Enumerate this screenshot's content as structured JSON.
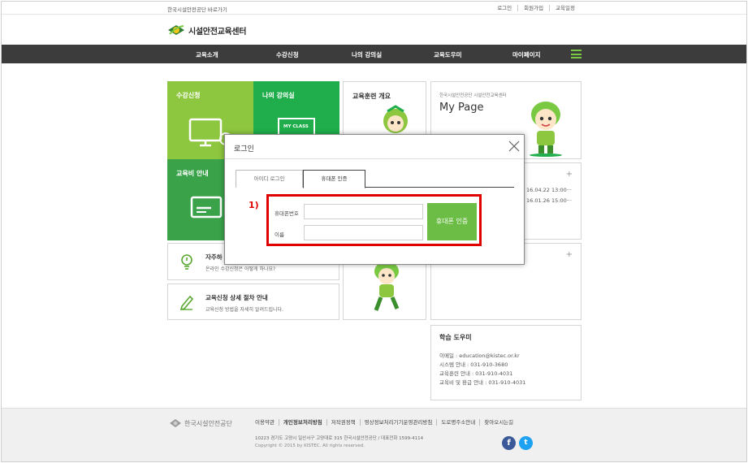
{
  "topbar": {
    "gov_link": "한국시설안전공단 바로가기",
    "util": [
      "로그인",
      "회원가입",
      "교육일정"
    ]
  },
  "logo": {
    "text": "시설안전교육센터"
  },
  "nav": {
    "items": [
      "교육소개",
      "수강신청",
      "나의 강의실",
      "교육도우미",
      "마이페이지"
    ]
  },
  "tiles": {
    "apply": "수강신청",
    "myclass": "나의 강의실",
    "myclass_badge": "MY CLASS",
    "fee": "교육비 안내",
    "overview": "교육훈련 개요",
    "mypage_sub": "한국시설안전공단 시설안전교육센터",
    "mypage_title": "My Page",
    "notice_dates": [
      "16.04.22 13:00···",
      "16.01.26 15:00···"
    ],
    "faq_title": "자주하",
    "faq_sub": "온라인 수강신청은 어떻게 하나요?",
    "guide_title": "교육신청 상세 절차 안내",
    "guide_sub": "교육신청 방법을 자세히 알려드립니다."
  },
  "help": {
    "title": "학습 도우미",
    "lines": [
      "이메일 : education@kistec.or.kr",
      "시스템 안내 : 031-910-3680",
      "교육훈련 안내 : 031-910-4031",
      "교육비 및 환급 안내 : 031-910-4031"
    ]
  },
  "modal": {
    "title": "로그인",
    "tabs": [
      "아이디 로그인",
      "휴대폰 인증"
    ],
    "annotation": "1)",
    "phone_label": "휴대폰번호",
    "name_label": "이름",
    "phone_value": "",
    "name_value": "",
    "auth_button": "휴대폰 인증"
  },
  "footer": {
    "org": "한국시설안전공단",
    "links": [
      "이용약관",
      "개인정보처리방침",
      "저작권정책",
      "영상정보처리기기운영관리방침",
      "도로명주소안내",
      "찾아오시는길"
    ],
    "address": "10223   경기도 고양시 일산서구 고양대로 315 한국시설안전공단  / 대표전화 1599-4114",
    "copyright": "Copyright © 2015 by KISTEC. All rights reserved.",
    "sns": [
      "f",
      "t"
    ]
  },
  "colors": {
    "lime": "#8dc63f",
    "green": "#1fae4b",
    "dark_green": "#3aa34a",
    "nav_bg": "#3c3c3c",
    "auth_button": "#6cbd45",
    "annotation_red": "#e00000"
  }
}
